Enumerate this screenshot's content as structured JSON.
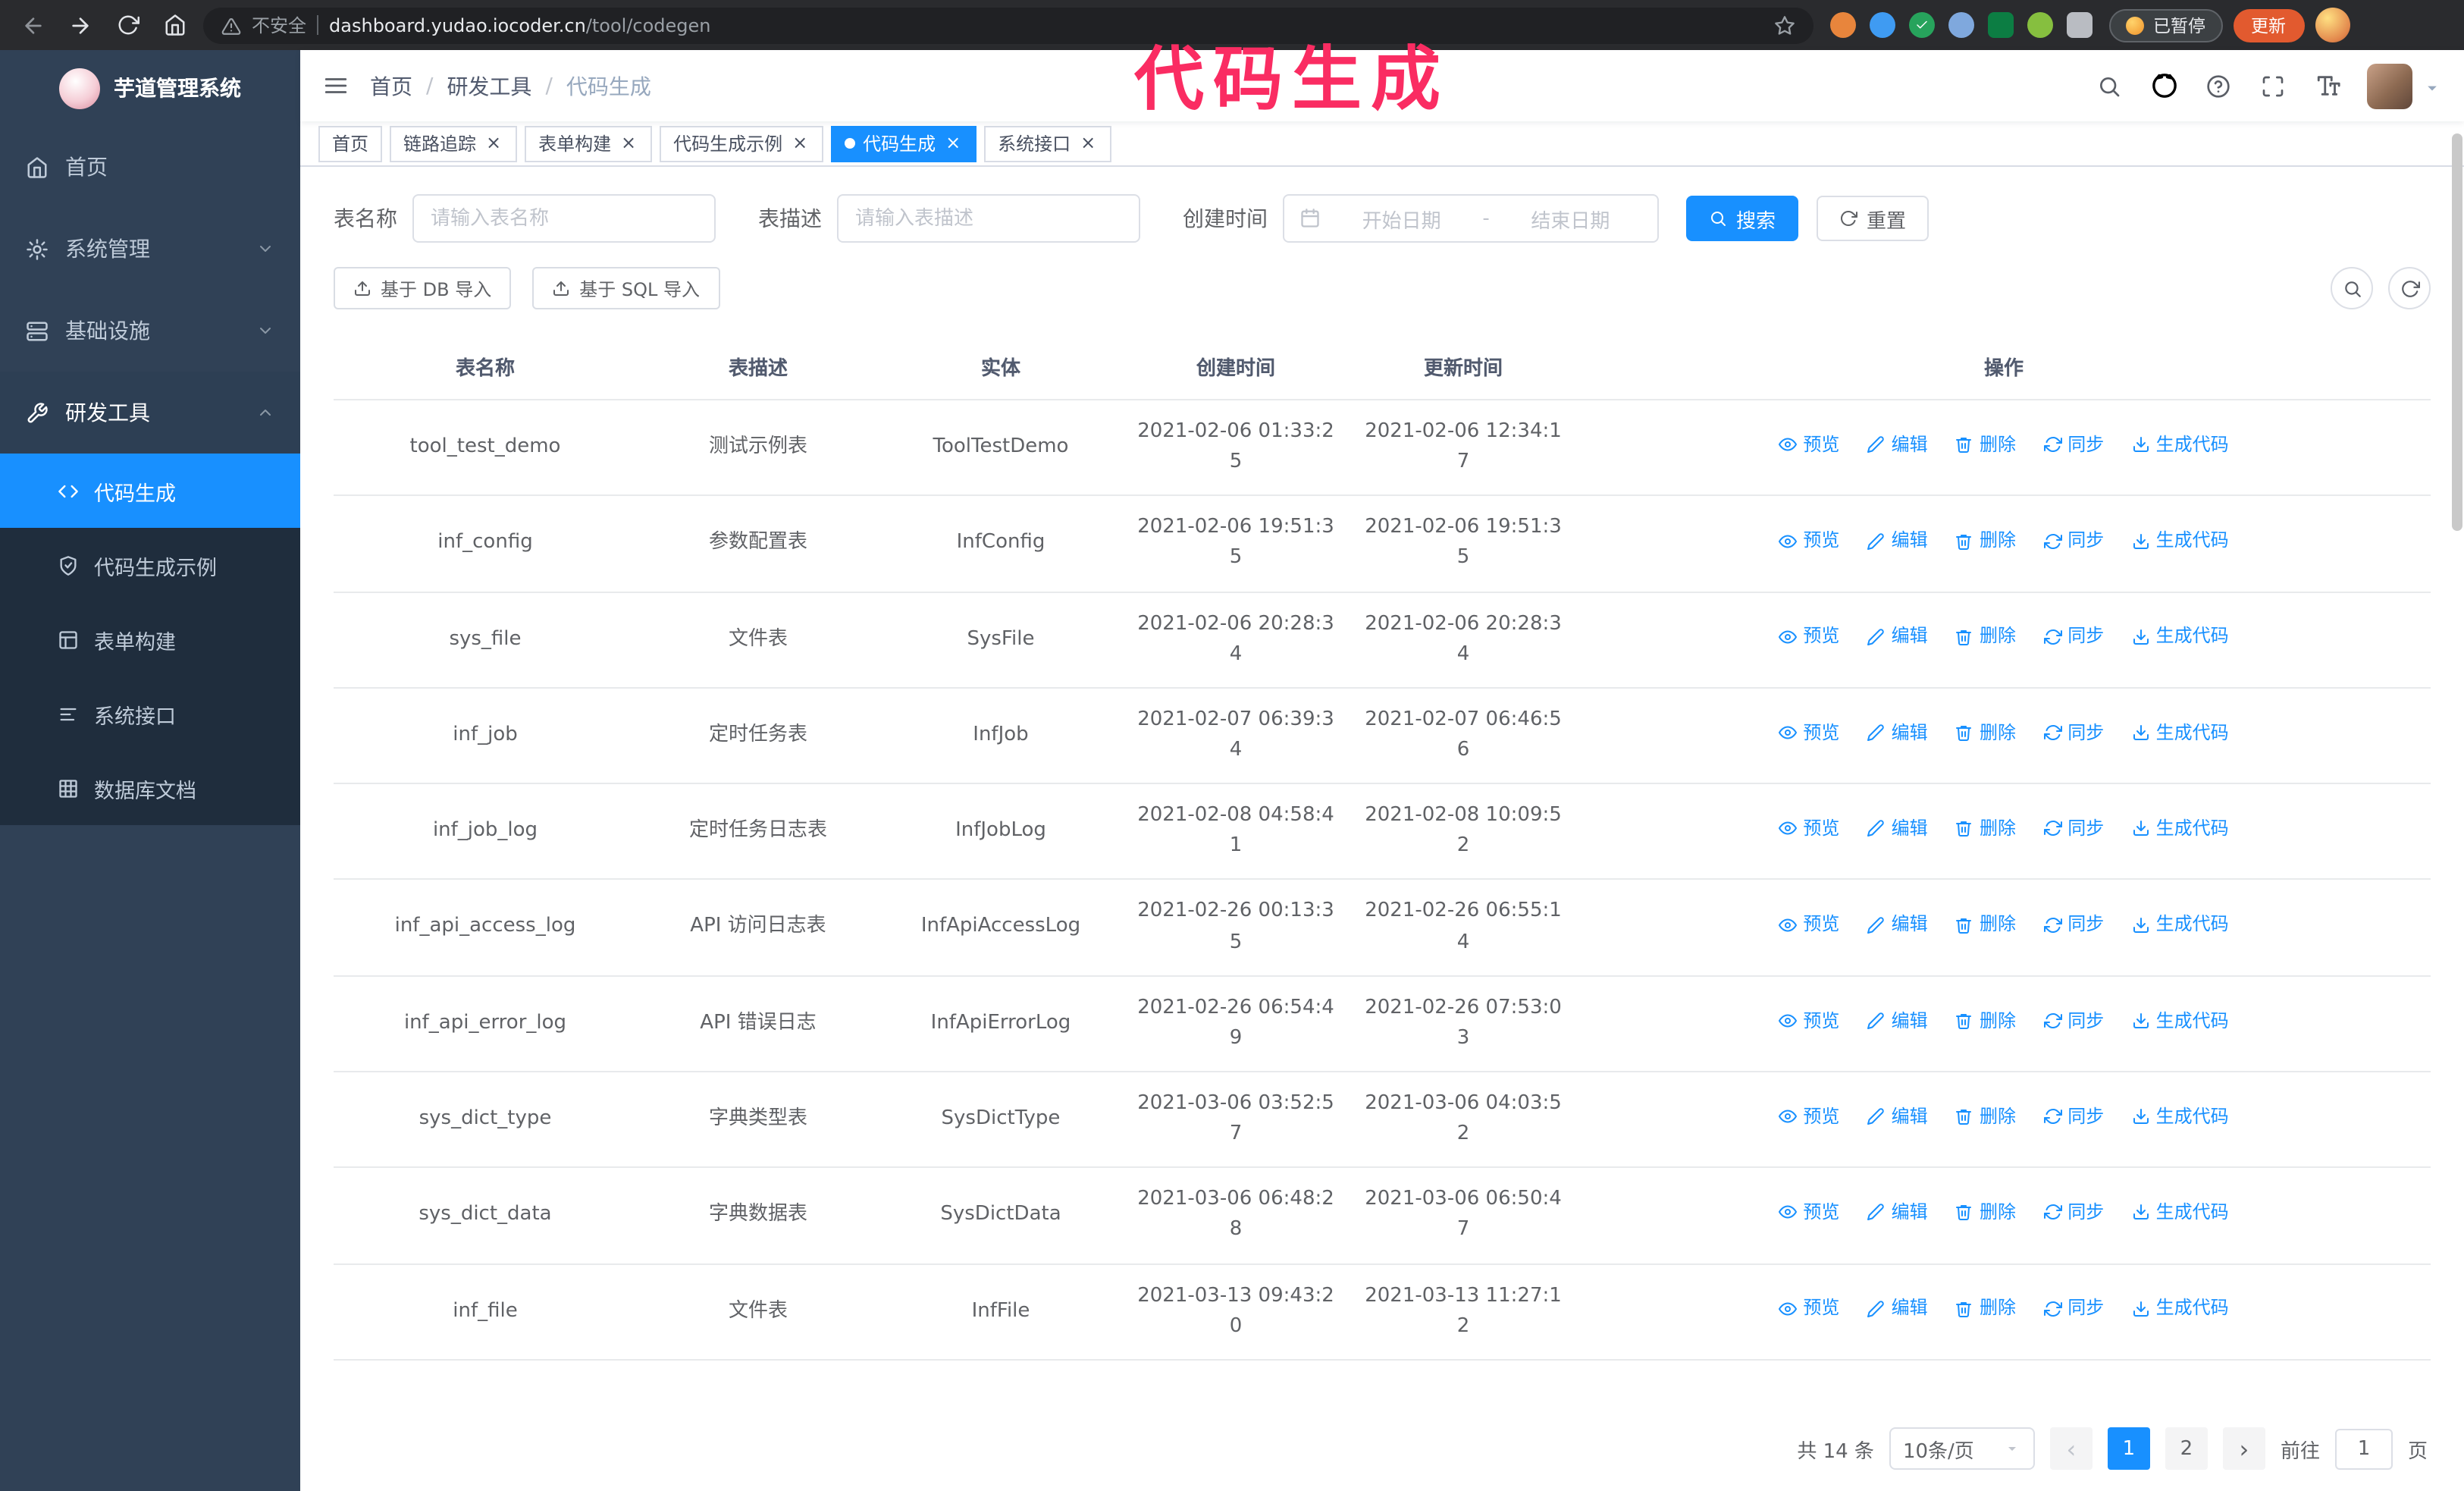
{
  "browser": {
    "security_label": "不安全",
    "url_host": "dashboard.yudao.iocoder.cn",
    "url_path": "/tool/codegen",
    "paused_label": "已暂停",
    "update_label": "更新"
  },
  "annotation": {
    "text": "代码生成",
    "color": "#fa2c62"
  },
  "sidebar": {
    "logo_title": "芋道管理系统",
    "items": [
      {
        "label": "首页"
      },
      {
        "label": "系统管理"
      },
      {
        "label": "基础设施"
      },
      {
        "label": "研发工具"
      }
    ],
    "sub_items": [
      {
        "label": "代码生成",
        "active": true
      },
      {
        "label": "代码生成示例"
      },
      {
        "label": "表单构建"
      },
      {
        "label": "系统接口"
      },
      {
        "label": "数据库文档"
      }
    ]
  },
  "navbar": {
    "breadcrumb": [
      "首页",
      "研发工具",
      "代码生成"
    ],
    "separator": "/"
  },
  "tabs": [
    {
      "label": "首页",
      "closable": false,
      "active": false
    },
    {
      "label": "链路追踪",
      "closable": true,
      "active": false
    },
    {
      "label": "表单构建",
      "closable": true,
      "active": false
    },
    {
      "label": "代码生成示例",
      "closable": true,
      "active": false
    },
    {
      "label": "代码生成",
      "closable": true,
      "active": true
    },
    {
      "label": "系统接口",
      "closable": true,
      "active": false
    }
  ],
  "filters": {
    "name_label": "表名称",
    "name_placeholder": "请输入表名称",
    "desc_label": "表描述",
    "desc_placeholder": "请输入表描述",
    "time_label": "创建时间",
    "start_placeholder": "开始日期",
    "range_sep": "-",
    "end_placeholder": "结束日期",
    "search_label": "搜索",
    "reset_label": "重置"
  },
  "toolbar": {
    "import_db_label": "基于 DB 导入",
    "import_sql_label": "基于 SQL 导入"
  },
  "table": {
    "columns": [
      "表名称",
      "表描述",
      "实体",
      "创建时间",
      "更新时间",
      "操作"
    ],
    "actions": [
      "预览",
      "编辑",
      "删除",
      "同步",
      "生成代码"
    ],
    "rows": [
      {
        "name": "tool_test_demo",
        "desc": "测试示例表",
        "entity": "ToolTestDemo",
        "created": "2021-02-06 01:33:25",
        "updated": "2021-02-06 12:34:17"
      },
      {
        "name": "inf_config",
        "desc": "参数配置表",
        "entity": "InfConfig",
        "created": "2021-02-06 19:51:35",
        "updated": "2021-02-06 19:51:35"
      },
      {
        "name": "sys_file",
        "desc": "文件表",
        "entity": "SysFile",
        "created": "2021-02-06 20:28:34",
        "updated": "2021-02-06 20:28:34"
      },
      {
        "name": "inf_job",
        "desc": "定时任务表",
        "entity": "InfJob",
        "created": "2021-02-07 06:39:34",
        "updated": "2021-02-07 06:46:56"
      },
      {
        "name": "inf_job_log",
        "desc": "定时任务日志表",
        "entity": "InfJobLog",
        "created": "2021-02-08 04:58:41",
        "updated": "2021-02-08 10:09:52"
      },
      {
        "name": "inf_api_access_log",
        "desc": "API 访问日志表",
        "entity": "InfApiAccessLog",
        "created": "2021-02-26 00:13:35",
        "updated": "2021-02-26 06:55:14"
      },
      {
        "name": "inf_api_error_log",
        "desc": "API 错误日志",
        "entity": "InfApiErrorLog",
        "created": "2021-02-26 06:54:49",
        "updated": "2021-02-26 07:53:03"
      },
      {
        "name": "sys_dict_type",
        "desc": "字典类型表",
        "entity": "SysDictType",
        "created": "2021-03-06 03:52:57",
        "updated": "2021-03-06 04:03:52"
      },
      {
        "name": "sys_dict_data",
        "desc": "字典数据表",
        "entity": "SysDictData",
        "created": "2021-03-06 06:48:28",
        "updated": "2021-03-06 06:50:47"
      },
      {
        "name": "inf_file",
        "desc": "文件表",
        "entity": "InfFile",
        "created": "2021-03-13 09:43:20",
        "updated": "2021-03-13 11:27:12"
      }
    ]
  },
  "pagination": {
    "total": "共 14 条",
    "size": "10条/页",
    "pages": [
      "1",
      "2"
    ],
    "goto_label": "前往",
    "goto_value": "1",
    "unit_label": "页"
  },
  "icons": {
    "close": "×",
    "prev": "‹",
    "next": "›"
  },
  "colors": {
    "accent": "#1890ff",
    "sidebar_bg": "#304156",
    "submenu_bg": "#1f2d3d"
  }
}
